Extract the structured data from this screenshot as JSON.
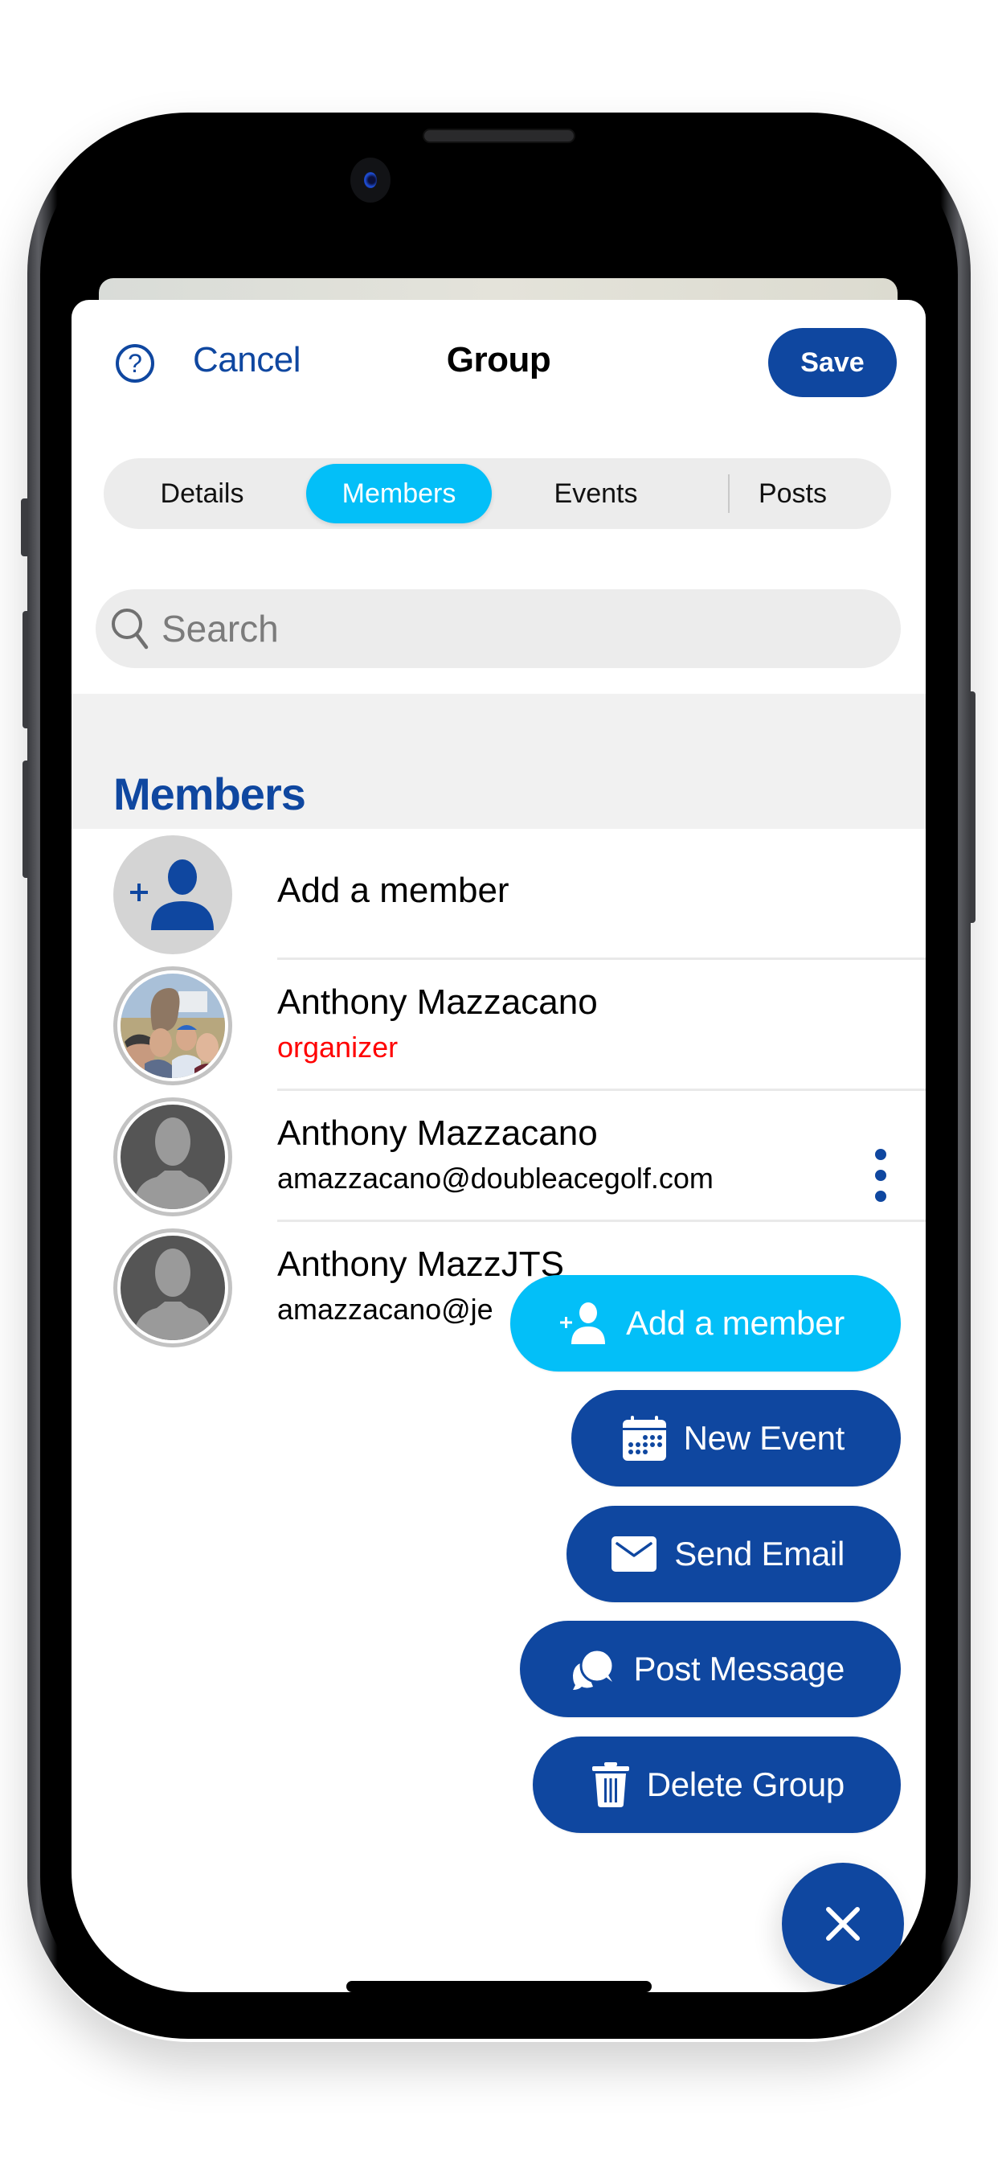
{
  "header": {
    "help_icon": "question-circle-icon",
    "help_glyph": "?",
    "cancel_label": "Cancel",
    "title": "Group",
    "save_label": "Save"
  },
  "tabs": [
    {
      "label": "Details",
      "active": false
    },
    {
      "label": "Members",
      "active": true
    },
    {
      "label": "Events",
      "active": false
    },
    {
      "label": "Posts",
      "active": false
    }
  ],
  "search": {
    "placeholder": "Search",
    "value": ""
  },
  "section": {
    "title": "Members"
  },
  "members_list": {
    "add_row": {
      "label": "Add a member",
      "icon": "add-person-icon"
    },
    "members": [
      {
        "name": "Anthony Mazzacano",
        "subtitle": "organizer",
        "subtitle_color": "#ff0000",
        "avatar": "photo"
      },
      {
        "name": "Anthony Mazzacano",
        "subtitle": "amazzacano@doubleacegolf.com",
        "subtitle_color": "#000000",
        "avatar": "placeholder",
        "has_more_menu": true
      },
      {
        "name": "Anthony MazzJTS",
        "subtitle": "amazzacano@je",
        "subtitle_color": "#000000",
        "avatar": "placeholder"
      }
    ]
  },
  "fab_menu": {
    "items": [
      {
        "label": "Add a member",
        "icon": "add-person-icon",
        "style": "light"
      },
      {
        "label": "New Event",
        "icon": "calendar-icon",
        "style": "dark"
      },
      {
        "label": "Send Email",
        "icon": "envelope-icon",
        "style": "dark"
      },
      {
        "label": "Post Message",
        "icon": "chat-bubbles-icon",
        "style": "dark"
      },
      {
        "label": "Delete Group",
        "icon": "trash-icon",
        "style": "dark"
      }
    ],
    "close_icon": "close-icon"
  },
  "colors": {
    "primary": "#0f47a0",
    "accent": "#03bff8",
    "organizer": "#ff0000",
    "section_bg": "#f1f1f1",
    "control_bg": "#ececec"
  }
}
